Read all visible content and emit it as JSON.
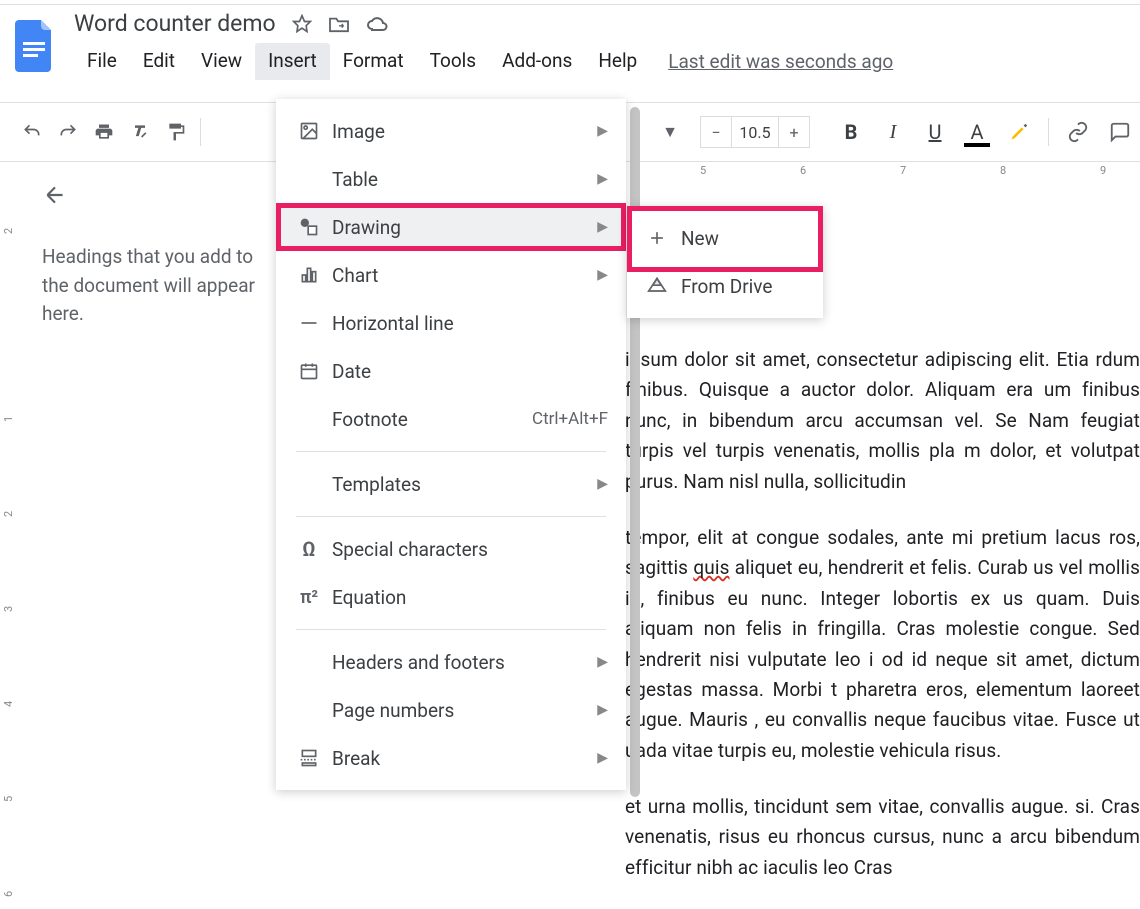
{
  "header": {
    "title": "Word counter demo",
    "menubar": [
      "File",
      "Edit",
      "View",
      "Insert",
      "Format",
      "Tools",
      "Add-ons",
      "Help"
    ],
    "active_menu_index": 3,
    "last_edit": "Last edit was seconds ago"
  },
  "toolbar": {
    "font_size": "10.5"
  },
  "outline": {
    "hint": "Headings that you add to the document will appear here."
  },
  "dropdown": {
    "items": [
      {
        "icon": "image-icon",
        "label": "Image",
        "has_sub": true
      },
      {
        "icon": "",
        "label": "Table",
        "has_sub": true
      },
      {
        "icon": "drawing-icon",
        "label": "Drawing",
        "has_sub": true,
        "highlight": true
      },
      {
        "icon": "chart-icon",
        "label": "Chart",
        "has_sub": true
      },
      {
        "icon": "hr-icon",
        "label": "Horizontal line",
        "has_sub": false
      },
      {
        "icon": "date-icon",
        "label": "Date",
        "has_sub": false
      },
      {
        "icon": "",
        "label": "Footnote",
        "has_sub": false,
        "shortcut": "Ctrl+Alt+F",
        "div_before": false
      },
      {
        "div": true
      },
      {
        "icon": "",
        "label": "Templates",
        "has_sub": true
      },
      {
        "div": true
      },
      {
        "icon": "omega-icon",
        "label": "Special characters",
        "has_sub": false
      },
      {
        "icon": "pi-icon",
        "label": "Equation",
        "has_sub": false
      },
      {
        "div": true
      },
      {
        "icon": "",
        "label": "Headers and footers",
        "has_sub": true
      },
      {
        "icon": "",
        "label": "Page numbers",
        "has_sub": true
      },
      {
        "icon": "break-icon",
        "label": "Break",
        "has_sub": true
      }
    ]
  },
  "submenu": {
    "items": [
      {
        "icon": "plus-icon",
        "label": "New",
        "highlight": true
      },
      {
        "icon": "drive-icon",
        "label": "From Drive"
      }
    ]
  },
  "document": {
    "p1": " ipsum dolor sit amet, consectetur adipiscing elit. Etia rdum finibus. Quisque a auctor dolor. Aliquam era um finibus nunc, in bibendum arcu accumsan vel. Se  Nam feugiat turpis vel turpis venenatis, mollis pla m dolor, et volutpat purus. Nam nisl nulla, sollicitudin ",
    "p2_a": "tempor, elit at congue sodales, ante mi pretium lacus ros, sagittis ",
    "p2_squiggle": "quis",
    "p2_b": " aliquet eu, hendrerit et felis. Curab us vel mollis id, finibus eu nunc. Integer lobortis ex us quam. Duis aliquam non felis in fringilla. Cras  molestie congue. Sed hendrerit nisi vulputate leo i od id neque sit amet, dictum egestas massa. Morbi t pharetra eros, elementum laoreet augue. Mauris , eu convallis neque faucibus vitae. Fusce ut  uada vitae turpis eu, molestie vehicula risus.",
    "p3": " et urna mollis, tincidunt sem vitae, convallis augue. si. Cras venenatis, risus eu rhoncus cursus, nunc a arcu bibendum  efficitur nibh ac  iaculis leo  Cras"
  },
  "ruler": {
    "h_numbers": [
      "5",
      "6",
      "7",
      "8",
      "9"
    ]
  }
}
